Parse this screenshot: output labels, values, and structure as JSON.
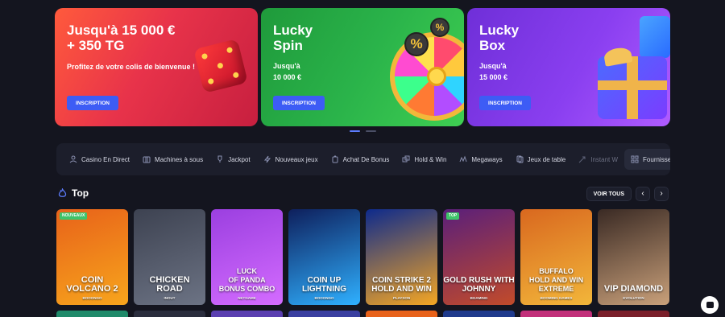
{
  "banners": [
    {
      "title": "Jusqu'à 15 000 €\n+ 350 TG",
      "subtitle": "Profitez de votre colis de bienvenue !",
      "button": "INSCRIPTION"
    },
    {
      "title": "Lucky\nSpin",
      "subtitle": "Jusqu'à\n10 000 €",
      "button": "INSCRIPTION"
    },
    {
      "title": "Lucky\nBox",
      "subtitle": "Jusqu'à\n15 000 €",
      "button": "INSCRIPTION"
    }
  ],
  "percent_symbol": "%",
  "categories": [
    {
      "label": "Casino En Direct",
      "icon": "live-dealer-icon"
    },
    {
      "label": "Machines à sous",
      "icon": "slot-machine-icon"
    },
    {
      "label": "Jackpot",
      "icon": "jackpot-icon"
    },
    {
      "label": "Nouveaux jeux",
      "icon": "new-games-icon"
    },
    {
      "label": "Achat De Bonus",
      "icon": "bonus-buy-icon"
    },
    {
      "label": "Hold & Win",
      "icon": "hold-win-icon"
    },
    {
      "label": "Megaways",
      "icon": "megaways-icon"
    },
    {
      "label": "Jeux de table",
      "icon": "table-games-icon"
    },
    {
      "label": "Instant W",
      "icon": "instant-win-icon"
    },
    {
      "label": "Fournisseurs",
      "icon": "providers-icon"
    }
  ],
  "top_section": {
    "title": "Top",
    "view_all": "VOIR TOUS",
    "prev": "‹",
    "next": "›"
  },
  "games": [
    {
      "name": "COIN\nVOLCANO 2",
      "provider": "BOOONGO",
      "tag": "NOUVEAUX",
      "bg": "#e8621a",
      "bg2": "#f7a51c"
    },
    {
      "name": "CHICKEN\nROAD",
      "provider": "INOUT",
      "tag": "",
      "bg": "#3d4251",
      "bg2": "#6c7384"
    },
    {
      "name": "LUCK\nOF PANDA\nBONUS COMBO",
      "provider": "NETGAME",
      "tag": "",
      "bg": "#9b3fe0",
      "bg2": "#d46cff"
    },
    {
      "name": "COIN UP\nLIGHTNING",
      "provider": "BOOONGO",
      "tag": "",
      "bg": "#0e1f5c",
      "bg2": "#2fb0ff"
    },
    {
      "name": "COIN STRIKE 2\nHOLD AND WIN",
      "provider": "PLAYSON",
      "tag": "",
      "bg": "#0d2a8c",
      "bg2": "#f5a623"
    },
    {
      "name": "GOLD RUSH WITH\nJOHNNY",
      "provider": "BGAMING",
      "tag": "TOP",
      "bg": "#5a1f7a",
      "bg2": "#c24b2a"
    },
    {
      "name": "BUFFALO\nHOLD AND WIN\nEXTREME",
      "provider": "BOOMING GAMES",
      "tag": "",
      "bg": "#d9681f",
      "bg2": "#f2b63a"
    },
    {
      "name": "VIP DIAMOND",
      "provider": "EVOLUTION",
      "tag": "",
      "bg": "#3a2a24",
      "bg2": "#c9a07a"
    }
  ],
  "row2_colors": [
    "#1f8a6a",
    "#2a2d3d",
    "#5a3fb0",
    "#3a3fa0",
    "#e8621a",
    "#1f3a8c",
    "#c2307a",
    "#7a1f2a"
  ]
}
